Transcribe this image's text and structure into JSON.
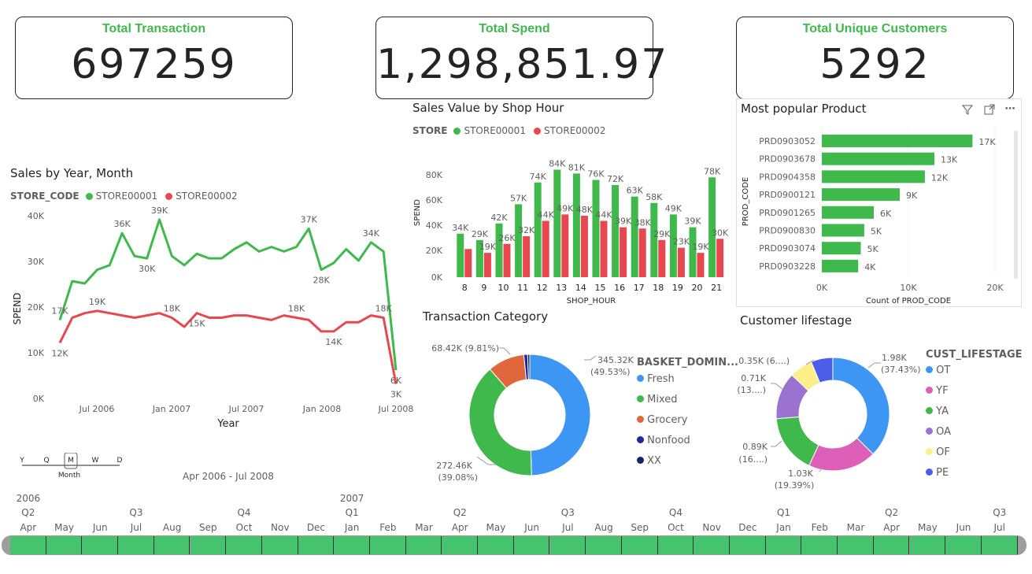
{
  "kpis": [
    {
      "title": "Total Transaction",
      "value": "697259"
    },
    {
      "title": "Total Spend",
      "value": "1,298,851.97"
    },
    {
      "title": "Total Unique Customers",
      "value": "5292"
    }
  ],
  "colors": {
    "green": "#3fb94b",
    "red": "#e8474f",
    "blue": "#3d96f4",
    "orange": "#e0673c",
    "navy": "#1a2a9b",
    "pink": "#dd5fb8",
    "purple": "#9b72cf",
    "yellow": "#fbef8a",
    "royal": "#4a5ee8"
  },
  "line_chart": {
    "title": "Sales by Year, Month",
    "legend_title": "STORE_CODE",
    "series_names": [
      "STORE00001",
      "STORE00002"
    ],
    "ylabel": "SPEND",
    "xlabel": "Year",
    "y_ticks": [
      "40K",
      "30K",
      "20K",
      "10K",
      "0K"
    ],
    "x_ticks": [
      "Jul 2006",
      "Jan 2007",
      "Jul 2007",
      "Jan 2008",
      "Jul 2008"
    ],
    "date_range": "Apr 2006 - Jul 2008",
    "drill_levels": [
      "Y",
      "Q",
      "M",
      "W",
      "D"
    ],
    "drill_selected": "Month"
  },
  "hour_chart": {
    "title": "Sales Value by Shop Hour",
    "legend_title": "STORE",
    "series_names": [
      "STORE00001",
      "STORE00002"
    ],
    "ylabel": "SPEND",
    "xlabel": "SHOP_HOUR",
    "y_ticks": [
      "80K",
      "60K",
      "40K",
      "20K",
      "0K"
    ]
  },
  "product_chart": {
    "title": "Most popular Product",
    "ylabel": "PROD_CODE",
    "xlabel": "Count of PROD_CODE",
    "x_ticks": [
      "0K",
      "10K",
      "20K"
    ]
  },
  "category_chart": {
    "title": "Transaction Category",
    "legend_title": "BASKET_DOMIN...",
    "legend": [
      "Fresh",
      "Mixed",
      "Grocery",
      "Nonfood",
      "XX"
    ],
    "labels": [
      {
        "text": "345.32K",
        "pct": "(49.53%)"
      },
      {
        "text": "272.46K",
        "pct": "(39.08%)"
      },
      {
        "text": "68.42K (9.81%)",
        "pct": ""
      }
    ]
  },
  "lifestage_chart": {
    "title": "Customer lifestage",
    "legend_title": "CUST_LIFESTAGE",
    "legend": [
      "OT",
      "YF",
      "YA",
      "OA",
      "OF",
      "PE"
    ],
    "labels": [
      {
        "text": "1.98K",
        "pct": "(37.43%)"
      },
      {
        "text": "1.03K",
        "pct": "(19.39%)"
      },
      {
        "text": "0.89K",
        "pct": "(16....)"
      },
      {
        "text": "0.71K",
        "pct": "(13....)"
      },
      {
        "text": "0.35K (6....)",
        "pct": ""
      }
    ]
  },
  "timeline": {
    "years": [
      {
        "label": "2006",
        "at": 0
      },
      {
        "label": "2007",
        "at": 9
      }
    ],
    "quarters": [
      {
        "label": "Q2",
        "at": 0
      },
      {
        "label": "Q3",
        "at": 3
      },
      {
        "label": "Q4",
        "at": 6
      },
      {
        "label": "Q1",
        "at": 9
      },
      {
        "label": "Q2",
        "at": 12
      },
      {
        "label": "Q3",
        "at": 15
      },
      {
        "label": "Q4",
        "at": 18
      },
      {
        "label": "Q1",
        "at": 21
      },
      {
        "label": "Q2",
        "at": 24
      },
      {
        "label": "Q3",
        "at": 27
      }
    ],
    "months": [
      "Apr",
      "May",
      "Jun",
      "Jul",
      "Aug",
      "Sep",
      "Oct",
      "Nov",
      "Dec",
      "Jan",
      "Feb",
      "Mar",
      "Apr",
      "May",
      "Jun",
      "Jul",
      "Aug",
      "Sep",
      "Oct",
      "Nov",
      "Dec",
      "Jan",
      "Feb",
      "Mar",
      "Apr",
      "May",
      "Jun",
      "Jul"
    ]
  },
  "chart_data": [
    {
      "type": "line",
      "title": "Sales by Year, Month",
      "xlabel": "Year",
      "ylabel": "SPEND",
      "ylim": [
        0,
        40000
      ],
      "x": [
        "Apr 2006",
        "May 2006",
        "Jun 2006",
        "Jul 2006",
        "Aug 2006",
        "Sep 2006",
        "Oct 2006",
        "Nov 2006",
        "Dec 2006",
        "Jan 2007",
        "Feb 2007",
        "Mar 2007",
        "Apr 2007",
        "May 2007",
        "Jun 2007",
        "Jul 2007",
        "Aug 2007",
        "Sep 2007",
        "Oct 2007",
        "Nov 2007",
        "Dec 2007",
        "Jan 2008",
        "Feb 2008",
        "Mar 2008",
        "Apr 2008",
        "May 2008",
        "Jun 2008",
        "Jul 2008"
      ],
      "series": [
        {
          "name": "STORE00001",
          "values": [
            17000,
            25500,
            25000,
            28000,
            29000,
            36000,
            31000,
            30500,
            39000,
            31000,
            29000,
            31500,
            30500,
            30500,
            32500,
            34000,
            32000,
            33000,
            32000,
            33000,
            37000,
            28000,
            29500,
            32500,
            30000,
            34000,
            32000,
            6000
          ],
          "labels": {
            "0": "17K",
            "8": "39K",
            "5": "36K",
            "7": "30K",
            "20": "37K",
            "21": "28K",
            "25": "34K",
            "27": "6K"
          }
        },
        {
          "name": "STORE00002",
          "values": [
            12000,
            17500,
            18500,
            19000,
            18500,
            18000,
            17500,
            18000,
            18500,
            17500,
            15500,
            18500,
            17500,
            17500,
            18000,
            18000,
            17500,
            17000,
            18000,
            17500,
            17000,
            14500,
            14500,
            16500,
            16500,
            18000,
            17500,
            3000
          ],
          "labels": {
            "0": "12K",
            "3": "19K",
            "9": "18K",
            "11": "15K",
            "19": "18K",
            "22": "14K",
            "26": "18K",
            "27": "3K"
          }
        }
      ]
    },
    {
      "type": "bar",
      "title": "Sales Value by Shop Hour",
      "xlabel": "SHOP_HOUR",
      "ylabel": "SPEND",
      "ylim": [
        0,
        90000
      ],
      "categories": [
        "8",
        "9",
        "10",
        "11",
        "12",
        "13",
        "14",
        "15",
        "16",
        "17",
        "18",
        "19",
        "20",
        "21"
      ],
      "series": [
        {
          "name": "STORE00001",
          "values": [
            34000,
            29000,
            42000,
            57000,
            74000,
            84000,
            81000,
            76000,
            72000,
            63000,
            58000,
            49000,
            39000,
            78000
          ],
          "labels": [
            "34K",
            "29K",
            "42K",
            "57K",
            "74K",
            "84K",
            "81K",
            "76K",
            "72K",
            "63K",
            "58K",
            "49K",
            "39K",
            "78K"
          ]
        },
        {
          "name": "STORE00002",
          "values": [
            22000,
            19000,
            26000,
            32000,
            44000,
            49000,
            48000,
            44000,
            39000,
            38000,
            29000,
            23000,
            19000,
            30000
          ],
          "labels": [
            "",
            "19K",
            "26K",
            "32K",
            "44K",
            "49K",
            "48K",
            "44K",
            "39K",
            "38K",
            "29K",
            "23K",
            "19K",
            "30K"
          ]
        }
      ]
    },
    {
      "type": "bar",
      "title": "Most popular Product",
      "xlabel": "Count of PROD_CODE",
      "ylabel": "PROD_CODE",
      "xlim": [
        0,
        20000
      ],
      "categories": [
        "PRD0903052",
        "PRD0903678",
        "PRD0904358",
        "PRD0900121",
        "PRD0901265",
        "PRD0900830",
        "PRD0903074",
        "PRD0903228"
      ],
      "values": [
        17400,
        13000,
        11900,
        9000,
        6000,
        4900,
        4500,
        4200
      ],
      "labels": [
        "17K",
        "13K",
        "12K",
        "9K",
        "6K",
        "5K",
        "5K",
        "4K"
      ]
    },
    {
      "type": "pie",
      "title": "Transaction Category",
      "categories": [
        "Fresh",
        "Mixed",
        "Grocery",
        "Nonfood",
        "XX"
      ],
      "values": [
        345320,
        272460,
        68420,
        7000,
        4000
      ]
    },
    {
      "type": "pie",
      "title": "Customer lifestage",
      "categories": [
        "OT",
        "YF",
        "YA",
        "OA",
        "OF",
        "PE"
      ],
      "values": [
        1980,
        1030,
        890,
        710,
        350,
        330
      ]
    }
  ]
}
